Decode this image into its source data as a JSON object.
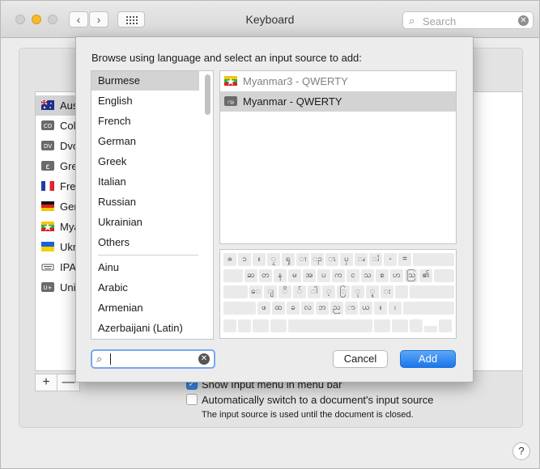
{
  "window": {
    "title": "Keyboard",
    "search_placeholder": "Search"
  },
  "input_sources": [
    {
      "label": "Australian",
      "icon": "flag-australia"
    },
    {
      "label": "Colemak",
      "icon": "badge-co"
    },
    {
      "label": "Dvorak",
      "icon": "badge-dv"
    },
    {
      "label": "Greek",
      "icon": "badge-greek"
    },
    {
      "label": "French",
      "icon": "flag-france"
    },
    {
      "label": "German",
      "icon": "flag-germany"
    },
    {
      "label": "Myanmar",
      "icon": "flag-myanmar"
    },
    {
      "label": "Ukrainian",
      "icon": "flag-ukraine"
    },
    {
      "label": "IPA",
      "icon": "keyboard-icon"
    },
    {
      "label": "Unicode",
      "icon": "badge-u-plus"
    }
  ],
  "background": {
    "show_menu_label": "Show Input menu in menu bar",
    "show_menu_checked": true,
    "auto_switch_label": "Automatically switch to a document's input source",
    "auto_switch_checked": false,
    "auto_switch_note": "The input source is used until the document is closed.",
    "plus": "+",
    "minus": "—",
    "help": "?"
  },
  "sheet": {
    "prompt": "Browse using language and select an input source to add:",
    "languages_top": [
      "Burmese",
      "English",
      "French",
      "German",
      "Greek",
      "Italian",
      "Russian",
      "Ukrainian",
      "Others"
    ],
    "languages_bottom": [
      "Ainu",
      "Arabic",
      "Armenian",
      "Azerbaijani (Latin)"
    ],
    "selected_language": "Burmese",
    "sources": [
      {
        "label": "Myanmar3 - QWERTY",
        "icon": "flag-myanmar",
        "dimmed": true,
        "selected": false
      },
      {
        "label": "Myanmar - QWERTY",
        "icon": "badge-myanmar-letter",
        "dimmed": false,
        "selected": true
      }
    ],
    "keyboard_rows": [
      [
        "ၐ",
        "ၥ",
        "။",
        "ၠ",
        "ၡ",
        "ၢ",
        "ၣ",
        "ၤ",
        "ၦ",
        "ၧ",
        "ၨ",
        "-",
        "="
      ],
      [
        "ဆ",
        "တ",
        "န",
        "မ",
        "အ",
        "ပ",
        "က",
        "င",
        "သ",
        "စ",
        "ဟ",
        "ဩ",
        "၏"
      ],
      [
        "ေ",
        "ျ",
        "ိ",
        "်",
        "ါ",
        "့",
        "ြ",
        "ု",
        "ူ",
        "း"
      ],
      [
        "ဖ",
        "ထ",
        "ခ",
        "လ",
        "ဘ",
        "ည",
        "ာ",
        "ယ",
        "။",
        "၊"
      ]
    ],
    "search_value": "",
    "cancel_label": "Cancel",
    "add_label": "Add"
  },
  "colors": {
    "accent": "#3b89e8",
    "selection": "#d3d3d3"
  }
}
